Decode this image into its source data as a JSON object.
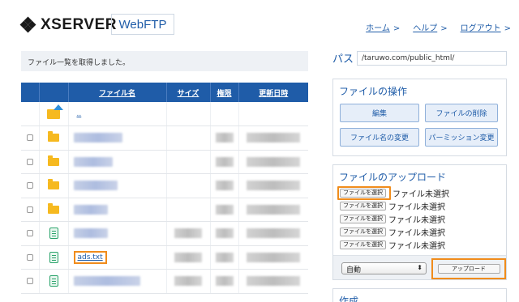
{
  "header": {
    "logo_text": "XSERVER",
    "product_badge": "WebFTP",
    "nav": [
      {
        "label": "ホーム"
      },
      {
        "label": "ヘルプ"
      },
      {
        "label": "ログアウト"
      }
    ]
  },
  "message": "ファイル一覧を取得しました。",
  "table": {
    "headers": [
      "ファイル名",
      "サイズ",
      "権限",
      "更新日時"
    ],
    "parent_link": "..",
    "rows": [
      {
        "type": "folder",
        "name": "",
        "redacted": true
      },
      {
        "type": "folder",
        "name": "",
        "redacted": true
      },
      {
        "type": "folder",
        "name": "",
        "redacted": true
      },
      {
        "type": "folder",
        "name": "",
        "redacted": true
      },
      {
        "type": "file",
        "name": "",
        "redacted": true
      },
      {
        "type": "file",
        "name": "ads.txt",
        "redacted": false
      },
      {
        "type": "file",
        "name": "",
        "redacted": true
      }
    ]
  },
  "path": {
    "label": "パス",
    "value": "/taruwo.com/public_html/"
  },
  "ops": {
    "title": "ファイルの操作",
    "buttons": [
      "編集",
      "ファイルの削除",
      "ファイル名の変更",
      "パーミッション変更"
    ]
  },
  "upload": {
    "title": "ファイルのアップロード",
    "choose_label": "ファイルを選択",
    "no_file": "ファイル未選択",
    "mode": "自動",
    "upload_button": "アップロード"
  },
  "create": {
    "title": "作成"
  },
  "colors": {
    "accent": "#1f5ca8",
    "highlight": "#f08c1c"
  }
}
